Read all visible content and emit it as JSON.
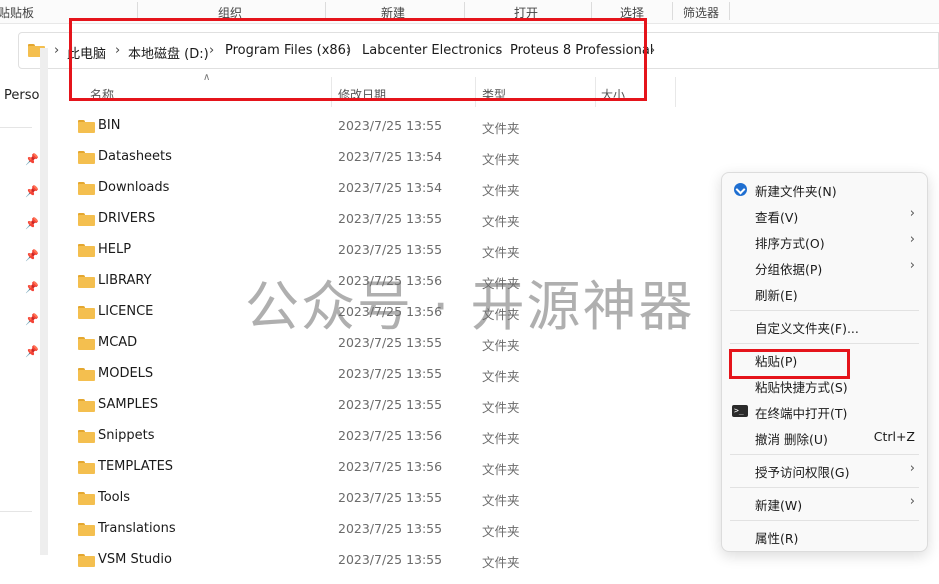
{
  "ribbon": {
    "groups": [
      "贴贴板",
      "组织",
      "新建",
      "打开",
      "选择",
      "筛选器"
    ]
  },
  "addressbar": {
    "icon": "folder-icon",
    "crumbs": [
      "此电脑",
      "本地磁盘 (D:)",
      "Program Files (x86)",
      "Labcenter Electronics",
      "Proteus 8 Professional"
    ]
  },
  "sidebar": {
    "partial_label": "Persor",
    "pin_icon": "pin-icon"
  },
  "columns": {
    "name": "名称",
    "modified": "修改日期",
    "type": "类型",
    "size": "大小"
  },
  "files": [
    {
      "name": "BIN",
      "modified": "2023/7/25 13:55",
      "type": "文件夹"
    },
    {
      "name": "Datasheets",
      "modified": "2023/7/25 13:54",
      "type": "文件夹"
    },
    {
      "name": "Downloads",
      "modified": "2023/7/25 13:54",
      "type": "文件夹"
    },
    {
      "name": "DRIVERS",
      "modified": "2023/7/25 13:55",
      "type": "文件夹"
    },
    {
      "name": "HELP",
      "modified": "2023/7/25 13:55",
      "type": "文件夹"
    },
    {
      "name": "LIBRARY",
      "modified": "2023/7/25 13:56",
      "type": "文件夹"
    },
    {
      "name": "LICENCE",
      "modified": "2023/7/25 13:56",
      "type": "文件夹"
    },
    {
      "name": "MCAD",
      "modified": "2023/7/25 13:55",
      "type": "文件夹"
    },
    {
      "name": "MODELS",
      "modified": "2023/7/25 13:55",
      "type": "文件夹"
    },
    {
      "name": "SAMPLES",
      "modified": "2023/7/25 13:55",
      "type": "文件夹"
    },
    {
      "name": "Snippets",
      "modified": "2023/7/25 13:56",
      "type": "文件夹"
    },
    {
      "name": "TEMPLATES",
      "modified": "2023/7/25 13:56",
      "type": "文件夹"
    },
    {
      "name": "Tools",
      "modified": "2023/7/25 13:55",
      "type": "文件夹"
    },
    {
      "name": "Translations",
      "modified": "2023/7/25 13:55",
      "type": "文件夹"
    },
    {
      "name": "VSM Studio",
      "modified": "2023/7/25 13:55",
      "type": "文件夹"
    }
  ],
  "watermark": "公众号 · 开源神器",
  "context_menu": {
    "new_folder": "新建文件夹(N)",
    "view": "查看(V)",
    "sort_by": "排序方式(O)",
    "group_by": "分组依据(P)",
    "refresh": "刷新(E)",
    "customize": "自定义文件夹(F)...",
    "paste": "粘贴(P)",
    "paste_shortcut": "粘贴快捷方式(S)",
    "open_terminal": "在终端中打开(T)",
    "undo_delete": "撤消 删除(U)",
    "undo_shortcut": "Ctrl+Z",
    "give_access": "授予访问权限(G)",
    "new": "新建(W)",
    "properties": "属性(R)",
    "submenu_arrow": "›",
    "terminal_glyph": ">_"
  },
  "colors": {
    "annotation_red": "#e5141b",
    "folder_yellow": "#f4bf4f",
    "accent_blue": "#1f6fd1"
  }
}
